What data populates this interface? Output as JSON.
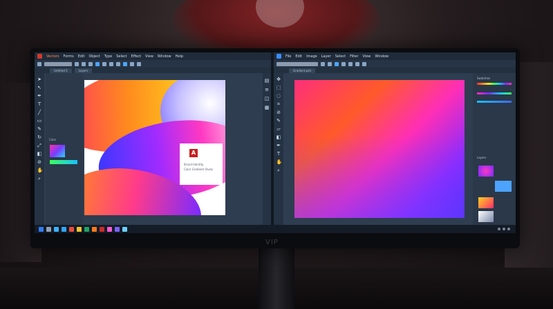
{
  "left_app": {
    "menu": [
      "Vectors",
      "Forms",
      "Edit",
      "Object",
      "Type",
      "Select",
      "Effect",
      "View",
      "Window",
      "Help"
    ],
    "tabs": [
      "Untitled-1",
      "Layers"
    ],
    "panel_label": "Color",
    "document": {
      "line1": "Brand Identity",
      "line2": "Color Gradient Study"
    }
  },
  "right_app": {
    "menu": [
      "File",
      "Edit",
      "Image",
      "Layer",
      "Select",
      "Filter",
      "View",
      "Window"
    ],
    "tabs": [
      "Gradient.psd"
    ],
    "panel_labels": [
      "Swatches",
      "Layers"
    ]
  },
  "monitor": {
    "brand": "VIP"
  },
  "taskbar": {
    "icon_colors": [
      "#2f7df6",
      "#8fa2b8",
      "#3bb2ff",
      "#31a6ff",
      "#e94b3c",
      "#f2c230",
      "#1fa463",
      "#ff7a1a",
      "#cc2b2b",
      "#ff5ad2",
      "#7b61ff",
      "#6ad0ff"
    ]
  },
  "colors": {
    "accent": "#4ea6ff",
    "app_logo": "#d23a2b",
    "window_bg": "#2e3d50"
  }
}
